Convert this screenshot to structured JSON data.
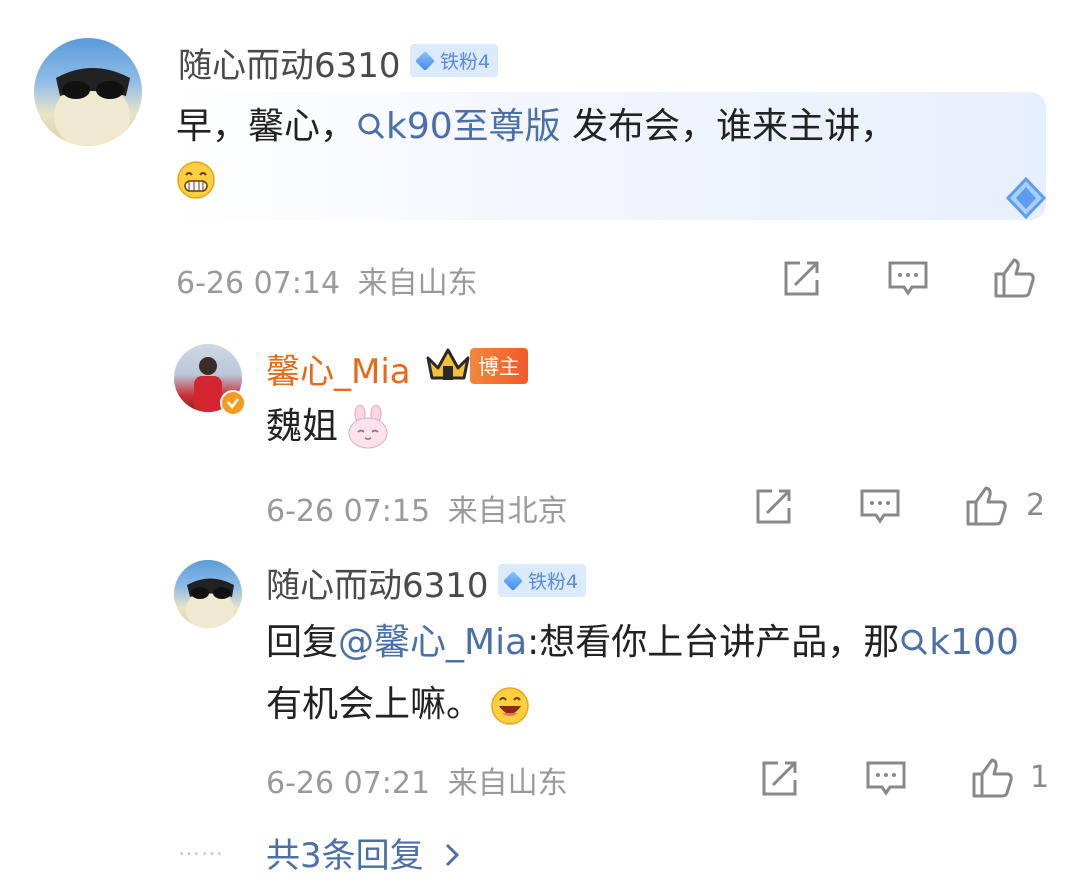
{
  "comment": {
    "user": "随心而动6310",
    "badge": "铁粉4",
    "text_before": "早，馨心，",
    "topic": "k90至尊版",
    "text_after": " 发布会，谁来主讲，",
    "emoji": "grin-emoji",
    "time": "6-26 07:14",
    "location": "来自山东"
  },
  "replies": [
    {
      "user": "馨心_Mia",
      "badge": "博主",
      "text": "魏姐",
      "emoji": "bunny-emoji",
      "time": "6-26 07:15",
      "location": "来自北京",
      "likes": "2"
    },
    {
      "user": "随心而动6310",
      "badge": "铁粉4",
      "prefix": "回复",
      "mention": "@馨心_Mia",
      "text_a": ":想看你上台讲产品，那",
      "topic": "k100",
      "text_b": " 有机会上嘛。",
      "emoji": "laugh-emoji",
      "time": "6-26 07:21",
      "location": "来自山东",
      "likes": "1"
    }
  ],
  "more_replies": "共3条回复",
  "dots": "……",
  "colors": {
    "username_vip": "#e86a18",
    "link": "#4b6fa8",
    "meta": "#9a9a9a",
    "fan_badge_bg": "#dbeafc"
  }
}
